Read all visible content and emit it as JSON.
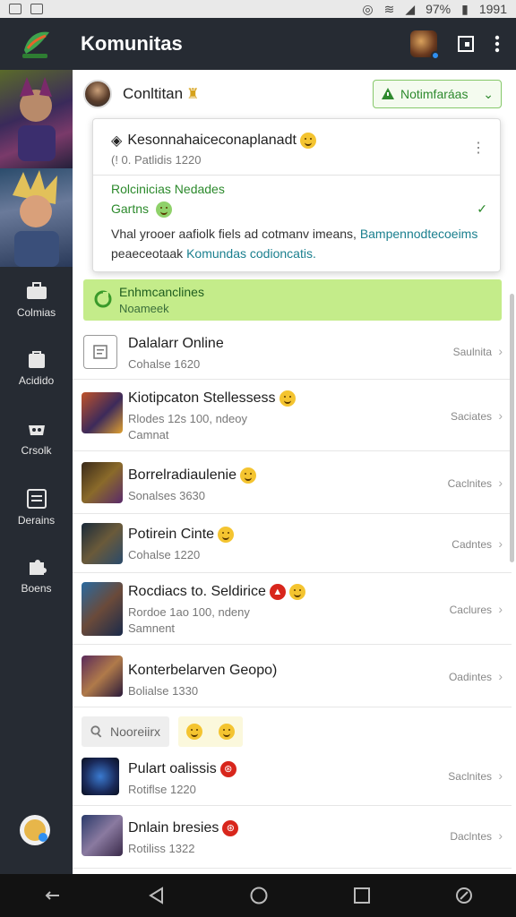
{
  "status_bar": {
    "battery": "97%",
    "time": "1991"
  },
  "app_bar": {
    "title": "Komunitas"
  },
  "side_nav": {
    "items": [
      {
        "label": "Colmias",
        "icon": "briefcase-icon"
      },
      {
        "label": "Acidido",
        "icon": "bag-icon"
      },
      {
        "label": "Crsolk",
        "icon": "controller-icon"
      },
      {
        "label": "Derains",
        "icon": "list-icon"
      },
      {
        "label": "Boens",
        "icon": "puzzle-icon"
      }
    ]
  },
  "community": {
    "name": "Conltitan",
    "notification_button": "Notimfaráas"
  },
  "popup": {
    "title": "Kesonnahaiceconaplanadt",
    "subtitle": "(! 0. Patlidis 1220",
    "green_line1": "Rolcinicias Nedades",
    "green_line2": "Gartns",
    "desc_line1_a": "Vhal yrooer aafiolk fiels ad cotmanv imeans, ",
    "desc_line1_link": "Bampennodtecoeims",
    "desc_line2_a": "peaeceotaak ",
    "desc_line2_link": "Komundas codioncatis."
  },
  "green_banner": {
    "title": "Enhmcanclines",
    "subtitle": "Noameek"
  },
  "list": [
    {
      "title": "Dalalarr Online",
      "sub": "Cohalse 1620",
      "action": "Saulnita"
    },
    {
      "title": "Kiotipcaton Stellessess",
      "sub": "Rlodes 12s 100, ndeoy",
      "sub2": "Camnat",
      "action": "Saciates"
    },
    {
      "title": "Borrelradiaulenie",
      "sub": "Sonalses 3630",
      "action": "Caclnites"
    },
    {
      "title": "Potirein Cinte",
      "sub": "Cohalse 1220",
      "action": "Cadntes"
    },
    {
      "title": "Rocdiacs to. Seldirice",
      "sub": "Rordoe 1ao 100, ndeny",
      "sub2": "Samnent",
      "action": "Caclures"
    },
    {
      "title": "Konterbelarven Geopo)",
      "sub": "Bolialse 1330",
      "action": "Oadintes"
    },
    {
      "title": "Pulart oalissis",
      "sub": "Rotiflse 1220",
      "action": "Saclnites"
    },
    {
      "title": "Dnlain bresies",
      "sub": "Rotiliss 1322",
      "action": "Daclntes"
    }
  ],
  "search": {
    "placeholder": "Nooreiirx"
  }
}
